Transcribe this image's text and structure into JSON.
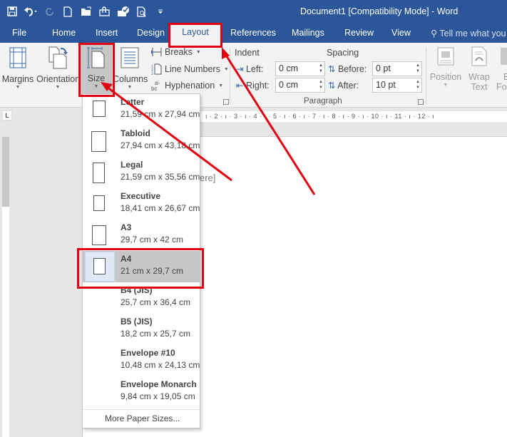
{
  "window": {
    "title": "Document1 [Compatibility Mode] - Word"
  },
  "quick_access": [
    {
      "name": "save-icon"
    },
    {
      "name": "undo-icon"
    },
    {
      "name": "redo-icon"
    },
    {
      "name": "new-document-icon"
    },
    {
      "name": "open-folder-icon"
    },
    {
      "name": "attach-icon"
    },
    {
      "name": "check-icon"
    },
    {
      "name": "print-preview-icon"
    },
    {
      "name": "customize-qat-icon"
    }
  ],
  "tabs": [
    "File",
    "Home",
    "Insert",
    "Design",
    "Layout",
    "References",
    "Mailings",
    "Review",
    "View"
  ],
  "active_tab": "Layout",
  "tell_me": "Tell me what you",
  "ribbon": {
    "page_setup": {
      "margins": "Margins",
      "orientation": "Orientation",
      "size": "Size",
      "columns": "Columns",
      "breaks": "Breaks",
      "line_numbers": "Line Numbers",
      "hyphenation": "Hyphenation"
    },
    "paragraph": {
      "group_label": "Paragraph",
      "indent_label": "Indent",
      "spacing_label": "Spacing",
      "left_label": "Left:",
      "left_value": "0 cm",
      "right_label": "Right:",
      "right_value": "0 cm",
      "before_label": "Before:",
      "before_value": "0 pt",
      "after_label": "After:",
      "after_value": "10 pt"
    },
    "arrange": {
      "position": "Position",
      "wrap_text_1": "Wrap",
      "wrap_text_2": "Text",
      "bring_forward_1": "B",
      "bring_forward_2": "For"
    }
  },
  "ruler": {
    "marks": "ı · 2 · ı · 3 · ı · 4 · ı · 5 · ı · 6 · ı · 7 · ı · 8 · ı · 9 · ı · 10 · ı · 11 · ı · 12 · ı"
  },
  "document": {
    "placeholder_fragment": "ere]"
  },
  "size_menu": {
    "items": [
      {
        "name": "Letter",
        "dims": "21,59 cm x 27,94 cm"
      },
      {
        "name": "Tabloid",
        "dims": "27,94 cm x 43,18 cm"
      },
      {
        "name": "Legal",
        "dims": "21,59 cm x 35,56 cm"
      },
      {
        "name": "Executive",
        "dims": "18,41 cm x 26,67 cm"
      },
      {
        "name": "A3",
        "dims": "29,7 cm x 42 cm"
      },
      {
        "name": "A4",
        "dims": "21 cm x 29,7 cm"
      },
      {
        "name": "B4 (JIS)",
        "dims": "25,7 cm x 36,4 cm"
      },
      {
        "name": "B5 (JIS)",
        "dims": "18,2 cm x 25,7 cm"
      },
      {
        "name": "Envelope #10",
        "dims": "10,48 cm x 24,13 cm"
      },
      {
        "name": "Envelope Monarch",
        "dims": "9,84 cm x 19,05 cm"
      }
    ],
    "selected": "A4",
    "more": "More Paper Sizes..."
  },
  "annotation_color": "#e00012"
}
